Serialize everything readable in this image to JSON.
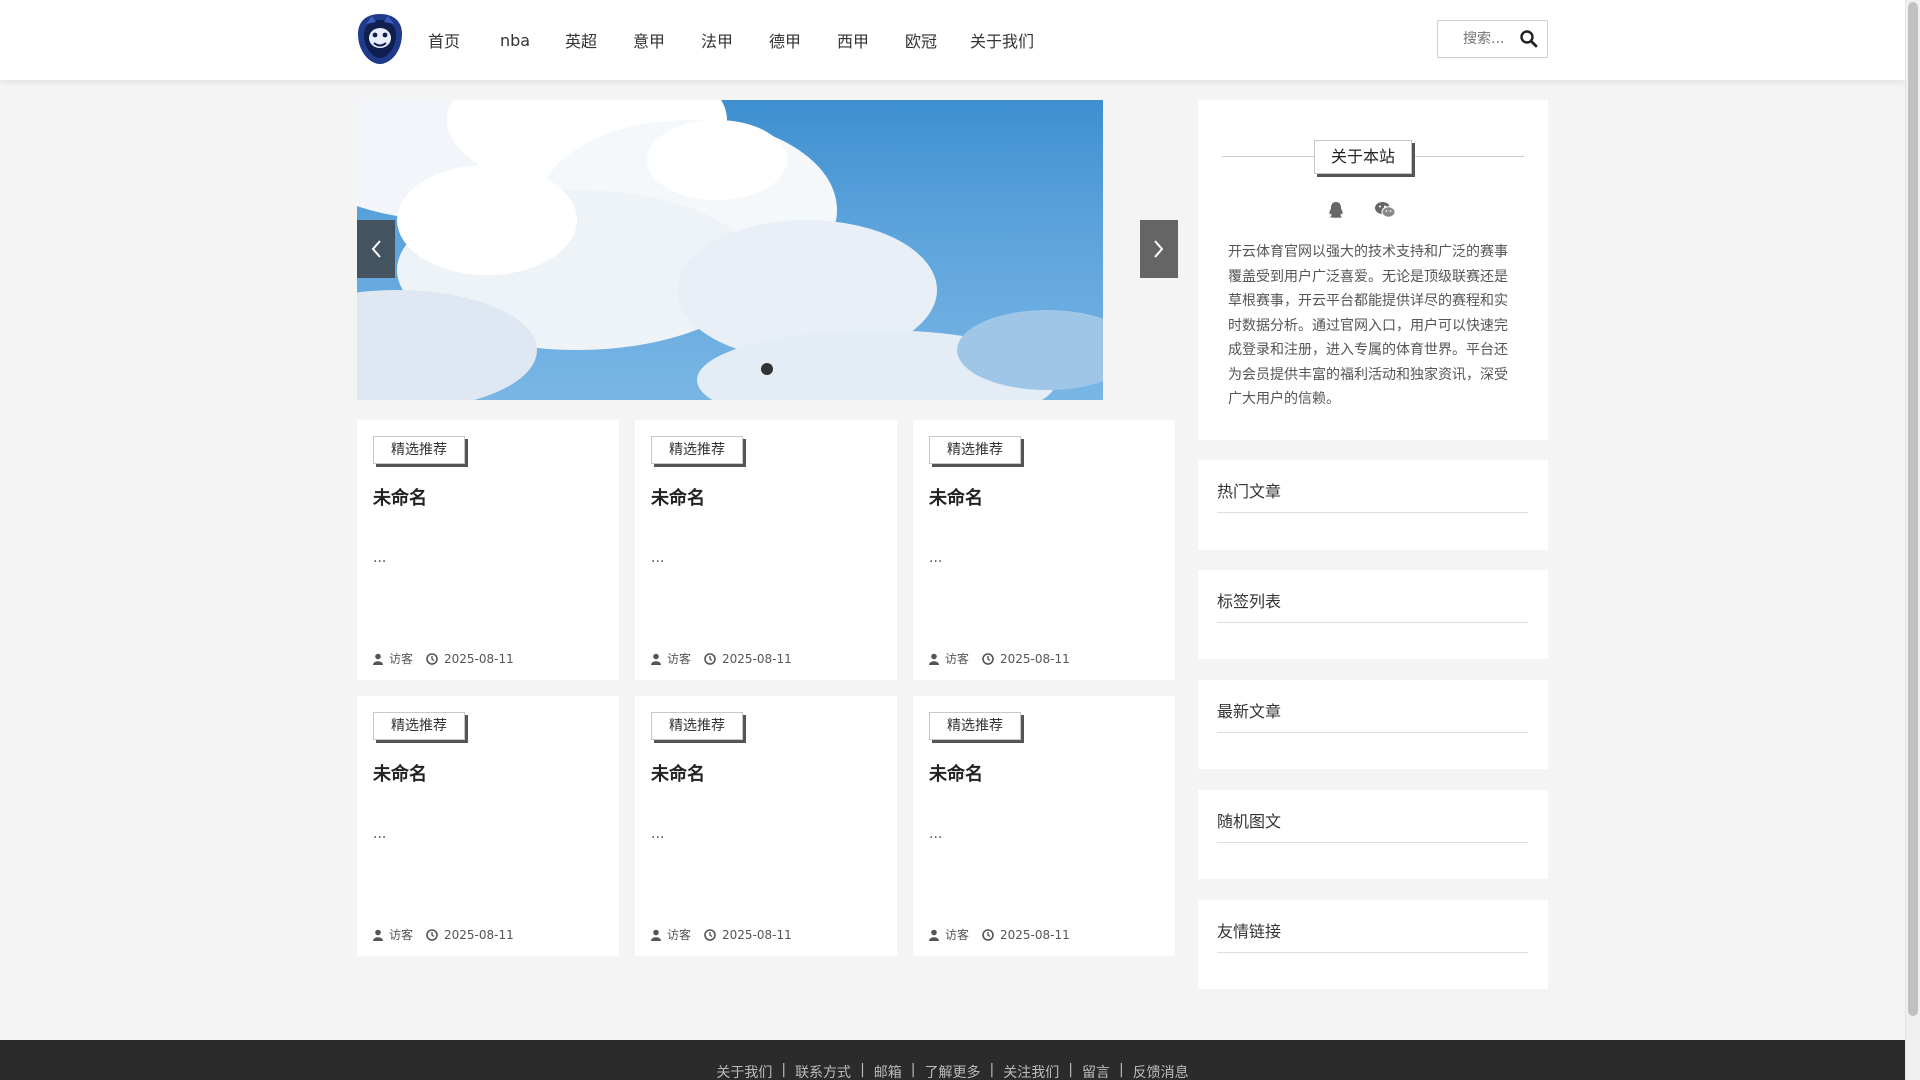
{
  "header": {
    "nav": [
      "首页",
      "nba",
      "英超",
      "意甲",
      "法甲",
      "德甲",
      "西甲",
      "欧冠",
      "关于我们"
    ],
    "search_placeholder": "搜索..."
  },
  "cards": [
    {
      "badge": "精选推荐",
      "title": "未命名",
      "excerpt": "...",
      "author": "访客",
      "date": "2025-08-11"
    },
    {
      "badge": "精选推荐",
      "title": "未命名",
      "excerpt": "...",
      "author": "访客",
      "date": "2025-08-11"
    },
    {
      "badge": "精选推荐",
      "title": "未命名",
      "excerpt": "...",
      "author": "访客",
      "date": "2025-08-11"
    },
    {
      "badge": "精选推荐",
      "title": "未命名",
      "excerpt": "...",
      "author": "访客",
      "date": "2025-08-11"
    },
    {
      "badge": "精选推荐",
      "title": "未命名",
      "excerpt": "...",
      "author": "访客",
      "date": "2025-08-11"
    },
    {
      "badge": "精选推荐",
      "title": "未命名",
      "excerpt": "...",
      "author": "访客",
      "date": "2025-08-11"
    }
  ],
  "sidebar": {
    "about_title": "关于本站",
    "about_text": "开云体育官网以强大的技术支持和广泛的赛事覆盖受到用户广泛喜爱。无论是顶级联赛还是草根赛事，开云平台都能提供详尽的赛程和实时数据分析。通过官网入口，用户可以快速完成登录和注册，进入专属的体育世界。平台还为会员提供丰富的福利活动和独家资讯，深受广大用户的信赖。",
    "widgets": [
      "热门文章",
      "标签列表",
      "最新文章",
      "随机图文",
      "友情链接"
    ]
  },
  "footer": {
    "links": [
      "关于我们",
      "联系方式",
      "邮箱",
      "了解更多",
      "关注我们",
      "留言",
      "反馈消息"
    ]
  },
  "icons": {
    "logo": "monkey-logo-icon",
    "search": "search-icon",
    "user": "user-icon",
    "clock": "clock-icon",
    "qq": "qq-icon",
    "wechat": "wechat-icon"
  },
  "colors": {
    "footer_bg": "#2b2b2b",
    "logo_blue": "#1f3b8a"
  }
}
